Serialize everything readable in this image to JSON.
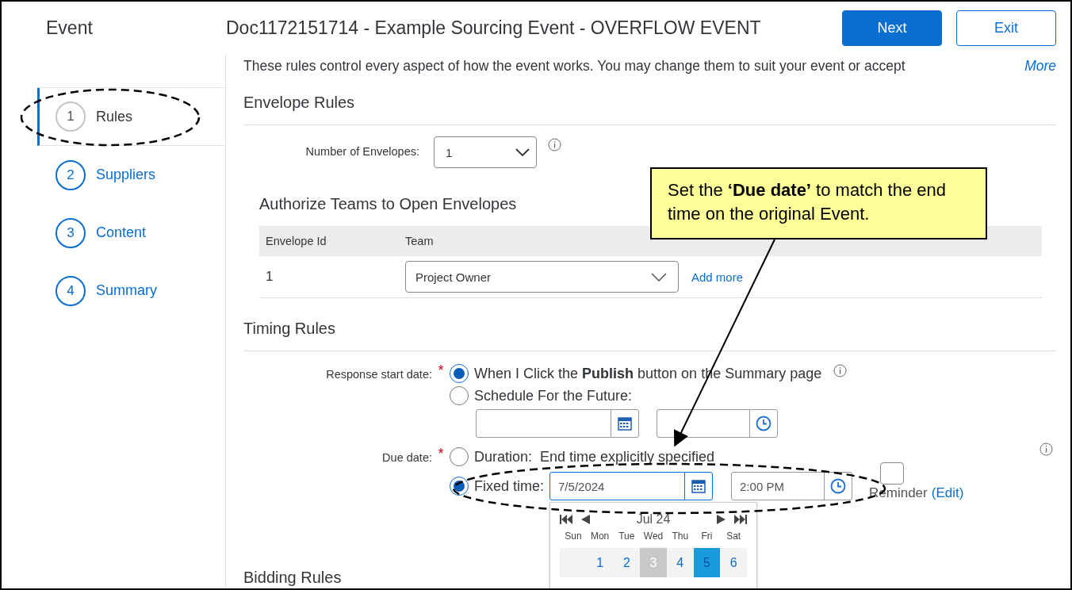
{
  "header": {
    "section_title": "Event",
    "document_title": "Doc1172151714 - Example Sourcing Event - OVERFLOW EVENT",
    "buttons": [
      {
        "label": "Next",
        "kind": "primary"
      },
      {
        "label": "Exit",
        "kind": "secondary"
      }
    ]
  },
  "sidebar": {
    "items": [
      {
        "number": "1",
        "label": "Rules",
        "selected": true
      },
      {
        "number": "2",
        "label": "Suppliers",
        "selected": false
      },
      {
        "number": "3",
        "label": "Content",
        "selected": false
      },
      {
        "number": "4",
        "label": "Summary",
        "selected": false
      }
    ]
  },
  "intro": {
    "text": "These rules control every aspect of how the event works. You may change them to suit your event or accept",
    "link": "More"
  },
  "envelope_rules": {
    "heading": "Envelope Rules",
    "count_label": "Number of Envelopes:",
    "count_value": "1",
    "teams_heading": "Authorize Teams to Open Envelopes",
    "table": {
      "columns": [
        "Envelope Id",
        "Team"
      ],
      "rows": [
        {
          "envelope_id": "1",
          "team": "Project Owner",
          "add_link": "Add more"
        }
      ]
    }
  },
  "timing_rules": {
    "heading": "Timing Rules",
    "response_start": {
      "label": "Response start date:",
      "required_mark": "*",
      "options": [
        {
          "label": "When I Click the **Publish** button on the Summary page",
          "selected": true
        },
        {
          "label": "Schedule For the Future:",
          "selected": false
        }
      ]
    },
    "due_date": {
      "label": "Due date:",
      "required_mark": "*",
      "options": [
        {
          "label": "Duration:  End time explicitly specified",
          "selected": false
        },
        {
          "label": "Fixed time:",
          "selected": true
        }
      ],
      "date": "7/5/2024",
      "time": "2:00 PM",
      "reminder": {
        "checked": false,
        "label": "Reminder",
        "link": "(Edit)"
      }
    }
  },
  "calendar": {
    "month": "Jul 24",
    "weekdays": [
      "Sun",
      "Mon",
      "Tue",
      "Wed",
      "Thu",
      "Fri",
      "Sat"
    ],
    "days": [
      {
        "kind": "blank"
      },
      {
        "kind": "day",
        "label": "1",
        "today": false,
        "selected": false
      },
      {
        "kind": "day",
        "label": "2",
        "today": false,
        "selected": false
      },
      {
        "kind": "day",
        "label": "3",
        "today": true,
        "selected": false
      },
      {
        "kind": "day",
        "label": "4",
        "today": false,
        "selected": false
      },
      {
        "kind": "day",
        "label": "5",
        "today": false,
        "selected": true
      },
      {
        "kind": "day",
        "label": "6",
        "today": false,
        "selected": false
      }
    ]
  },
  "next_section": {
    "heading": "Bidding Rules"
  },
  "callout": {
    "text": "Set the **‘Due date’** to match the end time on the original Event."
  }
}
